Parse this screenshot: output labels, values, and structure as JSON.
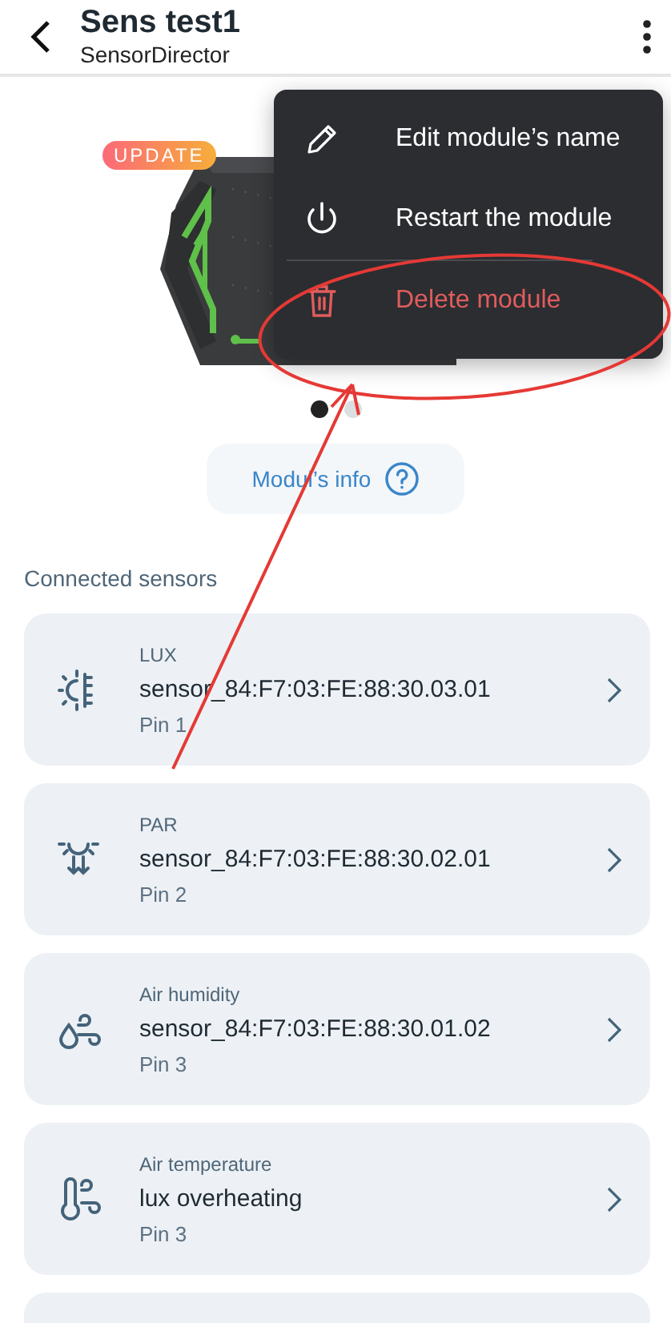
{
  "header": {
    "title": "Sens test1",
    "subtitle": "SensorDirector"
  },
  "module": {
    "badge": "UPDATE"
  },
  "carousel_dots": [
    {
      "selected": true
    },
    {
      "selected": false
    }
  ],
  "info_button": {
    "label": "Modul’s info"
  },
  "section_title": "Connected sensors",
  "sensors": [
    {
      "kind": "lux",
      "type": "LUX",
      "name": "sensor_84:F7:03:FE:88:30.03.01",
      "pin": "Pin 1"
    },
    {
      "kind": "par",
      "type": "PAR",
      "name": "sensor_84:F7:03:FE:88:30.02.01",
      "pin": "Pin 2"
    },
    {
      "kind": "humidity",
      "type": "Air humidity",
      "name": "sensor_84:F7:03:FE:88:30.01.02",
      "pin": "Pin 3"
    },
    {
      "kind": "temperature",
      "type": "Air temperature",
      "name": "lux overheating",
      "pin": "Pin 3"
    }
  ],
  "menu": [
    {
      "kind": "edit",
      "label": "Edit module’s name"
    },
    {
      "kind": "restart",
      "label": "Restart the module"
    },
    {
      "kind": "delete",
      "label": "Delete module"
    }
  ]
}
